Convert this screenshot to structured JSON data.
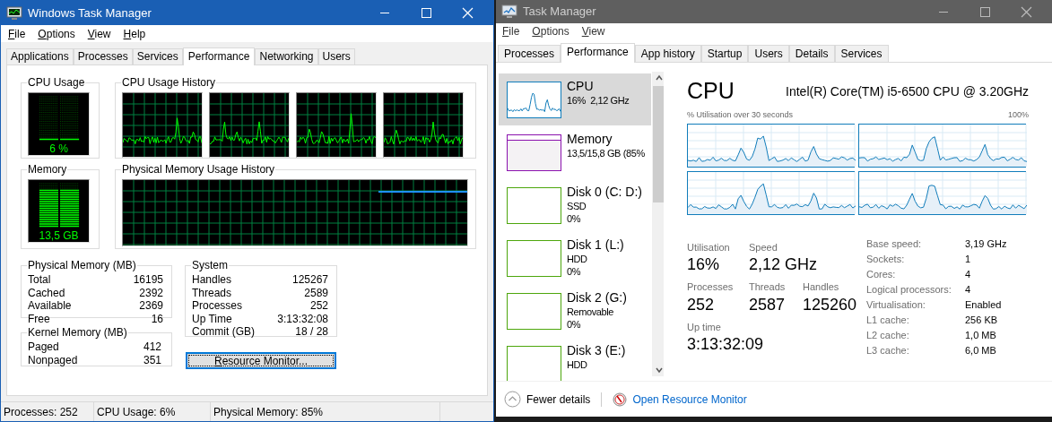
{
  "windows": [
    {
      "kind": "classic",
      "title": "Windows Task Manager",
      "menu": [
        "File",
        "Options",
        "View",
        "Help"
      ],
      "tabs": [
        {
          "label": "Applications",
          "selected": false
        },
        {
          "label": "Processes",
          "selected": false
        },
        {
          "label": "Services",
          "selected": false
        },
        {
          "label": "Performance",
          "selected": true
        },
        {
          "label": "Networking",
          "selected": false
        },
        {
          "label": "Users",
          "selected": false
        }
      ],
      "cpu_usage": {
        "title": "CPU Usage",
        "reading": "6 %",
        "level": 0.06
      },
      "cpu_history": {
        "title": "CPU Usage History"
      },
      "memory": {
        "title": "Memory",
        "reading": "13,5 GB",
        "level": 0.85
      },
      "memory_history": {
        "title": "Physical Memory Usage History"
      },
      "physical_memory": {
        "title": "Physical Memory (MB)",
        "rows": [
          {
            "label": "Total",
            "value": "16195"
          },
          {
            "label": "Cached",
            "value": "2392"
          },
          {
            "label": "Available",
            "value": "2369"
          },
          {
            "label": "Free",
            "value": "16"
          }
        ]
      },
      "kernel_memory": {
        "title": "Kernel Memory (MB)",
        "rows": [
          {
            "label": "Paged",
            "value": "412"
          },
          {
            "label": "Nonpaged",
            "value": "351"
          }
        ]
      },
      "system": {
        "title": "System",
        "rows": [
          {
            "label": "Handles",
            "value": "125267"
          },
          {
            "label": "Threads",
            "value": "2589"
          },
          {
            "label": "Processes",
            "value": "252"
          },
          {
            "label": "Up Time",
            "value": "3:13:32:08"
          },
          {
            "label": "Commit (GB)",
            "value": "18 / 28"
          }
        ]
      },
      "button": "Resource Monitor...",
      "status_bar": [
        "Processes: 252",
        "CPU Usage: 6%",
        "Physical Memory: 85%"
      ]
    },
    {
      "kind": "modern",
      "title": "Task Manager",
      "menu": [
        "File",
        "Options",
        "View"
      ],
      "tabs": [
        {
          "label": "Processes",
          "selected": false
        },
        {
          "label": "Performance",
          "selected": true
        },
        {
          "label": "App history",
          "selected": false
        },
        {
          "label": "Startup",
          "selected": false
        },
        {
          "label": "Users",
          "selected": false
        },
        {
          "label": "Details",
          "selected": false
        },
        {
          "label": "Services",
          "selected": false
        }
      ],
      "sidebar": {
        "items": [
          {
            "name": "CPU",
            "lines": [
              "16%  2,12 GHz"
            ],
            "selected": true,
            "color": "#117dbb"
          },
          {
            "name": "Memory",
            "lines": [
              "13,5/15,8 GB (85%"
            ],
            "selected": false,
            "color": "#8b12ae"
          },
          {
            "name": "Disk 0 (C: D:)",
            "lines": [
              "SSD",
              "0%"
            ],
            "selected": false,
            "color": "#4da60c"
          },
          {
            "name": "Disk 1 (L:)",
            "lines": [
              "HDD",
              "0%"
            ],
            "selected": false,
            "color": "#4da60c"
          },
          {
            "name": "Disk 2 (G:)",
            "lines": [
              "Removable",
              "0%"
            ],
            "selected": false,
            "color": "#4da60c"
          },
          {
            "name": "Disk 3 (E:)",
            "lines": [
              "HDD"
            ],
            "selected": false,
            "color": "#4da60c"
          }
        ]
      },
      "main": {
        "heading": "CPU",
        "model": "Intel(R) Core(TM) i5-6500 CPU @ 3.20GHz",
        "graph_caption": "% Utilisation over 30 seconds",
        "graph_max": "100%",
        "stat_rows": [
          [
            {
              "label": "Utilisation",
              "value": "16%"
            },
            {
              "label": "Speed",
              "value": "2,12 GHz"
            }
          ],
          [
            {
              "label": "Processes",
              "value": "252"
            },
            {
              "label": "Threads",
              "value": "2587"
            },
            {
              "label": "Handles",
              "value": "125260"
            }
          ],
          [
            {
              "label": "Up time",
              "value": "3:13:32:09"
            }
          ]
        ],
        "specs": [
          {
            "label": "Base speed:",
            "value": "3,19 GHz"
          },
          {
            "label": "Sockets:",
            "value": "1"
          },
          {
            "label": "Cores:",
            "value": "4"
          },
          {
            "label": "Logical processors:",
            "value": "4"
          },
          {
            "label": "Virtualisation:",
            "value": "Enabled"
          },
          {
            "label": "L1 cache:",
            "value": "256 KB"
          },
          {
            "label": "L2 cache:",
            "value": "1,0 MB"
          },
          {
            "label": "L3 cache:",
            "value": "6,0 MB"
          }
        ]
      },
      "footer": {
        "toggle": "Fewer details",
        "link": "Open Resource Monitor"
      }
    }
  ]
}
